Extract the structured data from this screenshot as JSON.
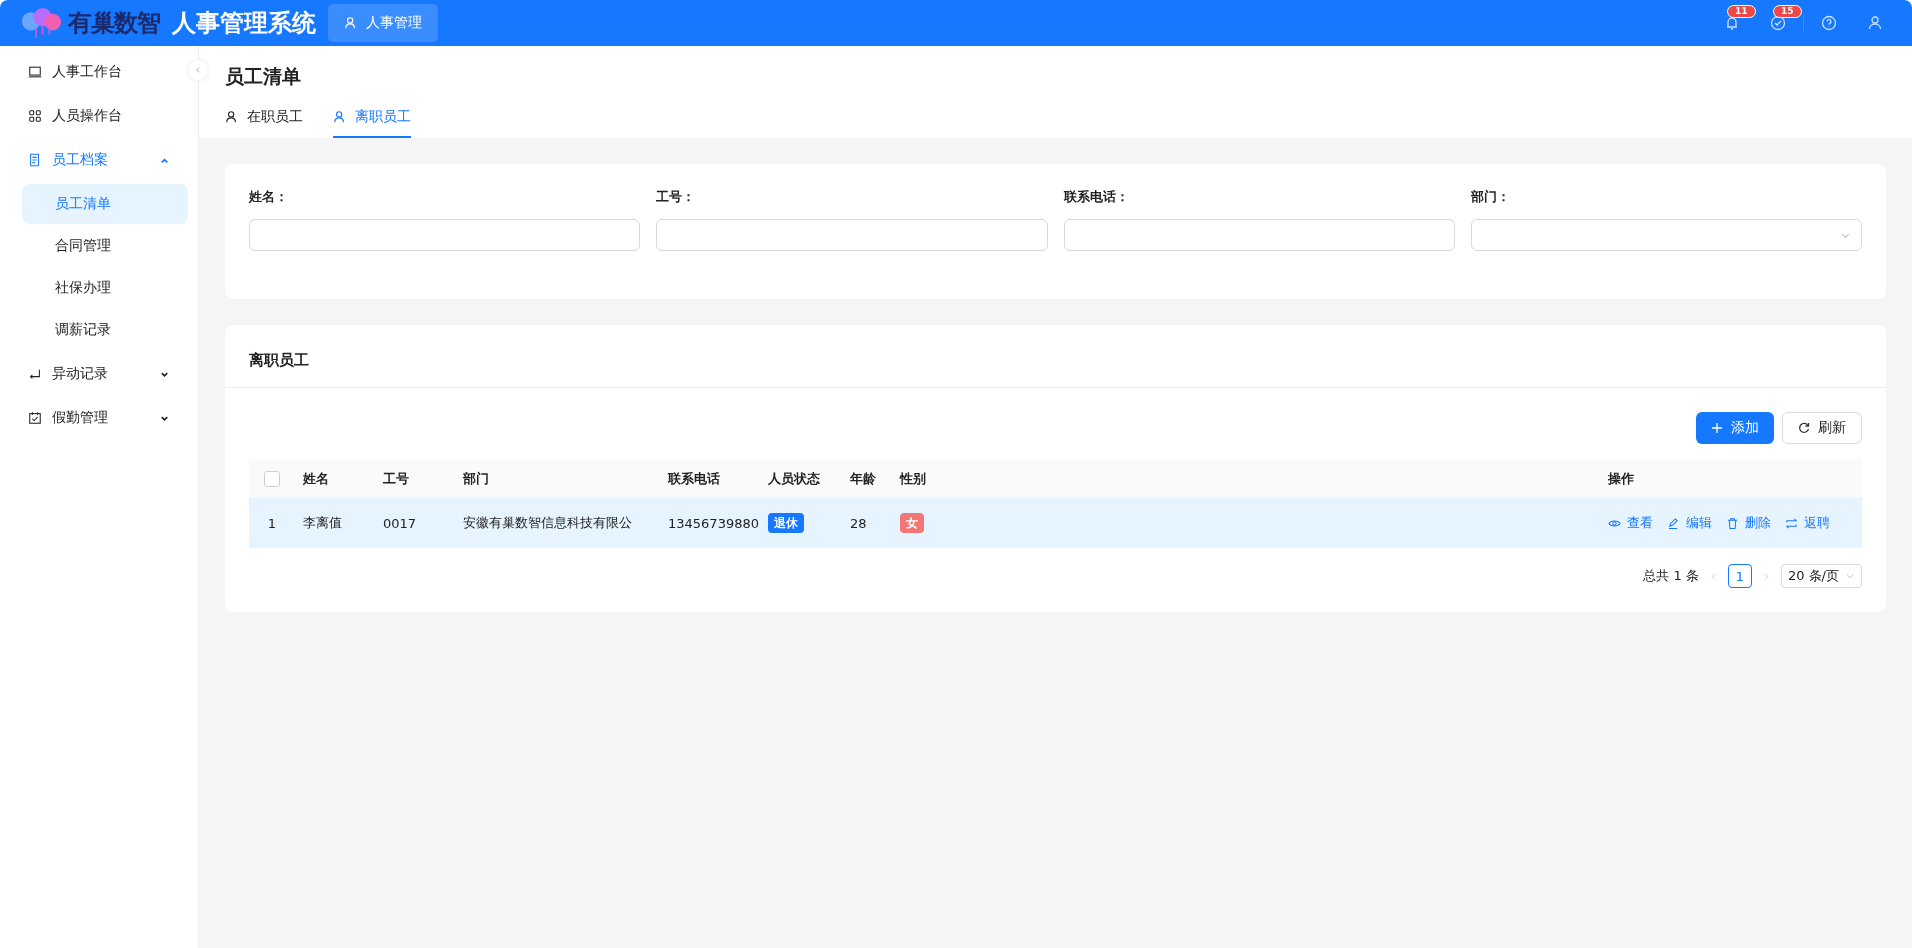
{
  "header": {
    "logo_text": "有巢数智",
    "system_title": "人事管理系统",
    "module_tabs": [
      {
        "label": "人事管理",
        "selected": true
      }
    ],
    "badges": [
      {
        "kind": "bell",
        "count": "11"
      },
      {
        "kind": "check",
        "count": "15"
      },
      {
        "kind": "help"
      },
      {
        "kind": "user"
      }
    ]
  },
  "sidebar": {
    "items": [
      {
        "label": "人事工作台",
        "selected": false
      },
      {
        "label": "人员操作台",
        "selected": false
      },
      {
        "label": "员工档案",
        "selected": true,
        "expanded": true,
        "children": [
          {
            "label": "员工清单",
            "selected": true
          },
          {
            "label": "合同管理",
            "selected": false
          },
          {
            "label": "社保办理",
            "selected": false
          },
          {
            "label": "调薪记录",
            "selected": false
          }
        ]
      },
      {
        "label": "异动记录",
        "selected": false,
        "expanded": false
      },
      {
        "label": "假勤管理",
        "selected": false,
        "expanded": false
      }
    ]
  },
  "page": {
    "title": "员工清单",
    "tabs": [
      {
        "label": "在职员工",
        "selected": false
      },
      {
        "label": "离职员工",
        "selected": true
      }
    ]
  },
  "filters": [
    {
      "label": "姓名：",
      "kind": "input"
    },
    {
      "label": "工号：",
      "kind": "input"
    },
    {
      "label": "联系电话：",
      "kind": "input"
    },
    {
      "label": "部门：",
      "kind": "select"
    }
  ],
  "table_card": {
    "title": "离职员工",
    "buttons": [
      {
        "label": "添加",
        "kind": "primary"
      },
      {
        "label": "刷新",
        "kind": "refresh"
      }
    ],
    "select_all": {
      "checked": false
    },
    "columns": [
      "姓名",
      "工号",
      "部门",
      "联系电话",
      "人员状态",
      "年龄",
      "性别",
      "操作"
    ],
    "rows": [
      {
        "index": "1",
        "name": "李离值",
        "number": "0017",
        "department": "安徽有巢数智信息科技有限公",
        "phone": "13456739880",
        "status": {
          "label": "退休",
          "color": "#1677ff"
        },
        "age": "28",
        "gender": {
          "label": "女",
          "color": "#f47575"
        },
        "actions": [
          {
            "label": "查看",
            "kind": "view"
          },
          {
            "label": "编辑",
            "kind": "edit"
          },
          {
            "label": "删除",
            "kind": "delete"
          },
          {
            "label": "返聘",
            "kind": "rehire"
          }
        ]
      }
    ]
  },
  "pagination": {
    "total": "总共 1 条",
    "pages": [
      {
        "label": "1",
        "selected": true
      }
    ],
    "page_size": "20 条/页"
  }
}
